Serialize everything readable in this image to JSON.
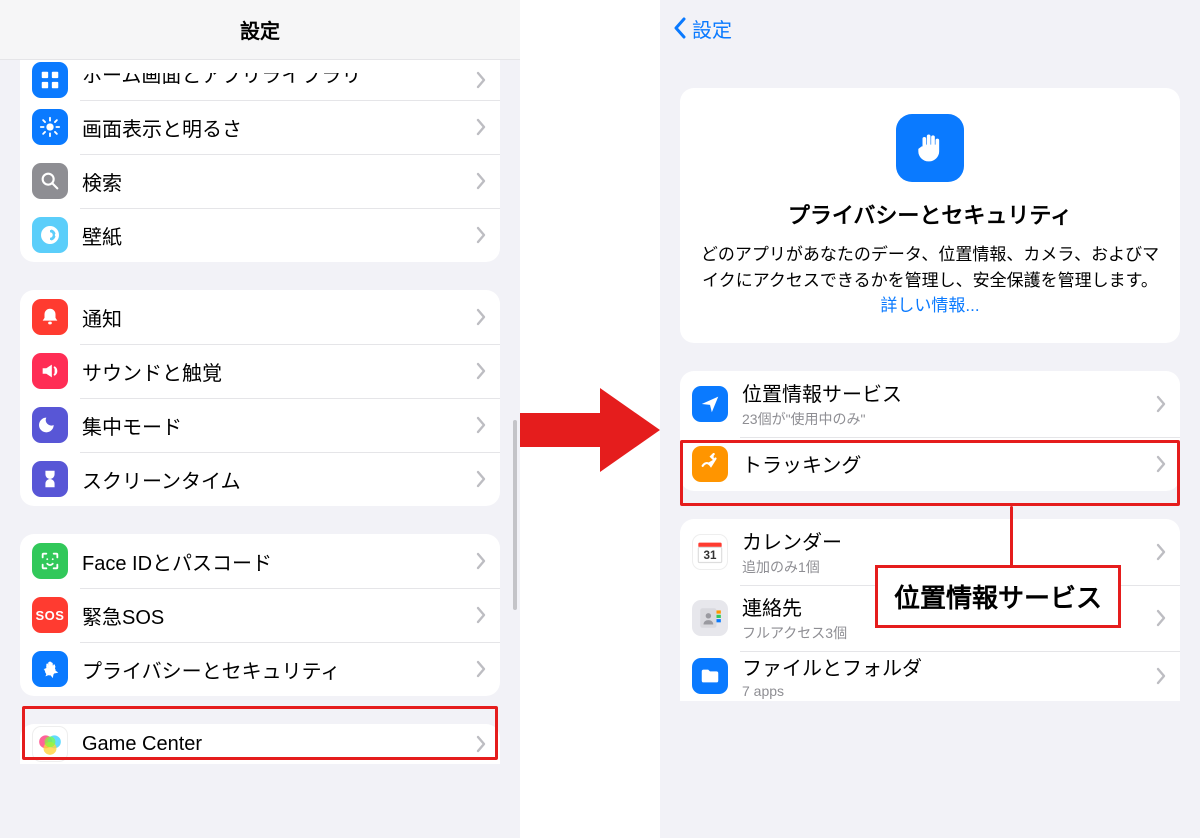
{
  "left": {
    "title": "設定",
    "group1": {
      "items": [
        {
          "label": "ホーム画面とアプリライブラリ",
          "icon": "home-library-icon",
          "bg": "ic-dblue"
        },
        {
          "label": "画面表示と明るさ",
          "icon": "brightness-icon",
          "bg": "ic-dblue"
        },
        {
          "label": "検索",
          "icon": "search-icon",
          "bg": "ic-gray"
        },
        {
          "label": "壁紙",
          "icon": "wallpaper-icon",
          "bg": "ic-cyan"
        }
      ]
    },
    "group2": {
      "items": [
        {
          "label": "通知",
          "icon": "notifications-icon",
          "bg": "ic-red"
        },
        {
          "label": "サウンドと触覚",
          "icon": "sound-icon",
          "bg": "ic-red"
        },
        {
          "label": "集中モード",
          "icon": "focus-icon",
          "bg": "ic-purple"
        },
        {
          "label": "スクリーンタイム",
          "icon": "screentime-icon",
          "bg": "ic-purple"
        }
      ]
    },
    "group3": {
      "items": [
        {
          "label": "Face IDとパスコード",
          "icon": "faceid-icon",
          "bg": "ic-green"
        },
        {
          "label": "緊急SOS",
          "icon": "sos-icon",
          "bg": "ic-sosred",
          "text": "SOS"
        },
        {
          "label": "プライバシーとセキュリティ",
          "icon": "privacy-icon",
          "bg": "ic-dblue"
        }
      ]
    },
    "group4": {
      "items": [
        {
          "label": "Game Center",
          "icon": "gamecenter-icon",
          "bg": "ic-white"
        }
      ]
    }
  },
  "right": {
    "back": "設定",
    "card": {
      "title": "プライバシーとセキュリティ",
      "desc": "どのアプリがあなたのデータ、位置情報、カメラ、およびマイクにアクセスできるかを管理し、安全保護を管理します。 ",
      "link": "詳しい情報..."
    },
    "group1": {
      "items": [
        {
          "label": "位置情報サービス",
          "sub": "23個が\"使用中のみ\"",
          "icon": "location-icon",
          "bg": "ic-dblue"
        },
        {
          "label": "トラッキング",
          "icon": "tracking-icon",
          "bg": "ic-orange"
        }
      ]
    },
    "group2": {
      "items": [
        {
          "label": "カレンダー",
          "sub": "追加のみ1個",
          "icon": "calendar-icon",
          "bg": "ic-white"
        },
        {
          "label": "連絡先",
          "sub": "フルアクセス3個",
          "icon": "contacts-icon",
          "bg": "ic-white"
        },
        {
          "label": "ファイルとフォルダ",
          "sub": "7 apps",
          "icon": "files-icon",
          "bg": "ic-dblue"
        }
      ]
    }
  },
  "callout": "位置情報サービス"
}
